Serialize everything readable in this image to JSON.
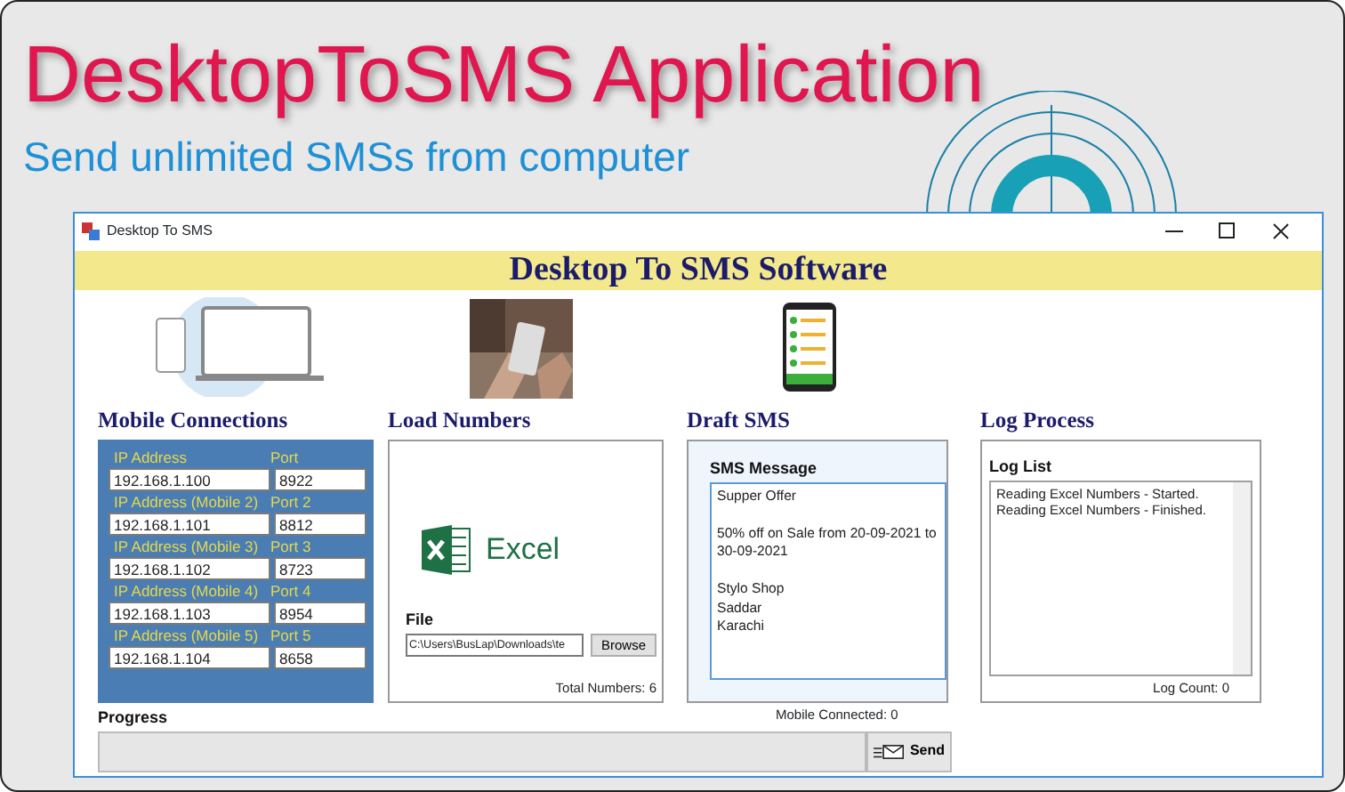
{
  "banner": {
    "title": "DesktopToSMS Application",
    "subtitle": "Send unlimited SMSs from computer"
  },
  "window": {
    "title": "Desktop To SMS",
    "header": "Desktop To SMS Software"
  },
  "mobile_connections": {
    "heading": "Mobile Connections",
    "connections": [
      {
        "ip_label": "IP Address",
        "port_label": "Port",
        "ip": "192.168.1.100",
        "port": "8922"
      },
      {
        "ip_label": "IP Address (Mobile 2)",
        "port_label": "Port 2",
        "ip": "192.168.1.101",
        "port": "8812"
      },
      {
        "ip_label": "IP Address  (Mobile 3)",
        "port_label": "Port 3",
        "ip": "192.168.1.102",
        "port": "8723"
      },
      {
        "ip_label": "IP Address  (Mobile 4)",
        "port_label": "Port 4",
        "ip": "192.168.1.103",
        "port": "8954"
      },
      {
        "ip_label": "IP Address  (Mobile 5)",
        "port_label": "Port 5",
        "ip": "192.168.1.104",
        "port": "8658"
      }
    ]
  },
  "load_numbers": {
    "heading": "Load Numbers",
    "logo_text": "Excel",
    "file_label": "File",
    "file_path": "C:\\Users\\BusLap\\Downloads\\te",
    "browse_button": "Browse",
    "total": "Total Numbers: 6"
  },
  "draft_sms": {
    "heading": "Draft SMS",
    "message_label": "SMS Message",
    "message": "Supper Offer\n\n50% off on Sale from 20-09-2021 to 30-09-2021\n\nStylo Shop\nSaddar\nKarachi"
  },
  "log_process": {
    "heading": "Log Process",
    "log_label": "Log List",
    "entries": [
      "Reading Excel Numbers - Started.",
      "Reading Excel Numbers - Finished."
    ],
    "count": "Log Count: 0"
  },
  "status": {
    "mobile_connected": "Mobile Connected: 0"
  },
  "progress": {
    "label": "Progress",
    "level": 0
  },
  "send_button": "Send"
}
